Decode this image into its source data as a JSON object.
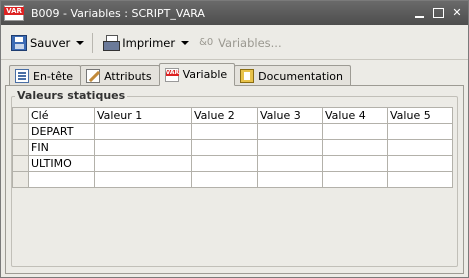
{
  "window": {
    "title": "B009 - Variables : SCRIPT_VARA",
    "icon_tag": "VAR"
  },
  "toolbar": {
    "save_label": "Sauver",
    "print_label": "Imprimer",
    "variables_label": "Variables..."
  },
  "tabs": [
    {
      "label": "En-tête",
      "icon": "header-icon"
    },
    {
      "label": "Attributs",
      "icon": "attributes-icon"
    },
    {
      "label": "Variable",
      "icon": "variable-icon",
      "active": true
    },
    {
      "label": "Documentation",
      "icon": "documentation-icon"
    }
  ],
  "group": {
    "title": "Valeurs statiques"
  },
  "table": {
    "columns": [
      "Clé",
      "Valeur 1",
      "Value 2",
      "Value 3",
      "Value 4",
      "Value 5"
    ],
    "rows": [
      [
        "DEPART",
        "",
        "",
        "",
        "",
        ""
      ],
      [
        "FIN",
        "",
        "",
        "",
        "",
        ""
      ],
      [
        "ULTIMO",
        "",
        "",
        "",
        "",
        ""
      ],
      [
        "",
        "",
        "",
        "",
        "",
        ""
      ]
    ]
  }
}
